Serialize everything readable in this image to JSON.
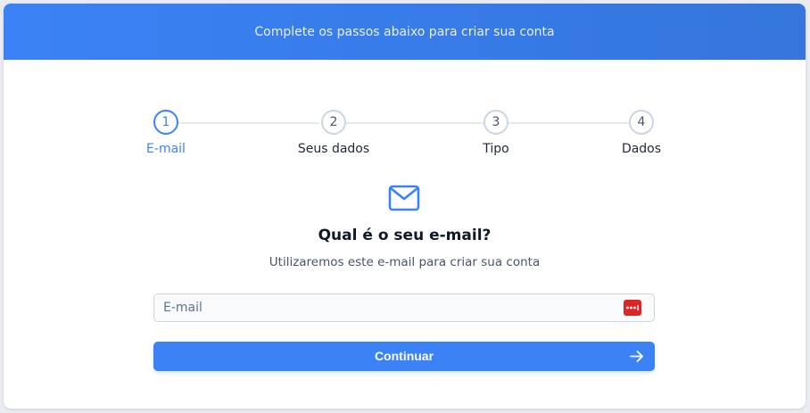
{
  "header": {
    "text": "Complete os passos abaixo para criar sua conta"
  },
  "stepper": {
    "current_step": 1,
    "steps": [
      {
        "number": "1",
        "label": "E-mail"
      },
      {
        "number": "2",
        "label": "Seus dados"
      },
      {
        "number": "3",
        "label": "Tipo"
      },
      {
        "number": "4",
        "label": "Dados"
      }
    ]
  },
  "main": {
    "icon": "mail-icon",
    "title": "Qual é o seu e-mail?",
    "subtitle": "Utilizaremos este e-mail para criar sua conta"
  },
  "email_field": {
    "placeholder": "E-mail",
    "value": "",
    "password_manager_icon": "password-manager-icon"
  },
  "continue_button": {
    "label": "Continuar",
    "icon": "arrow-right-icon"
  },
  "colors": {
    "accent": "#3b82f6",
    "password_manager": "#dc2626"
  }
}
